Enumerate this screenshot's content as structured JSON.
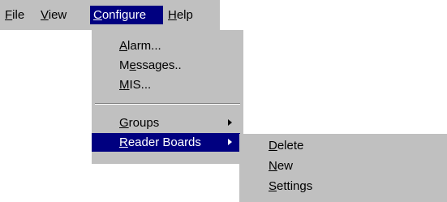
{
  "menubar": {
    "items": [
      {
        "mnemonic": "F",
        "rest": "ile"
      },
      {
        "mnemonic": "V",
        "rest": "iew"
      },
      {
        "mnemonic": "C",
        "rest": "onfigure"
      },
      {
        "mnemonic": "H",
        "rest": "elp"
      }
    ]
  },
  "configure_menu": {
    "items": [
      {
        "pre": "",
        "mnemonic": "A",
        "rest": "larm..."
      },
      {
        "pre": "M",
        "mnemonic": "e",
        "rest": "ssages.."
      },
      {
        "pre": "",
        "mnemonic": "M",
        "rest": "IS..."
      },
      {
        "pre": "",
        "mnemonic": "G",
        "rest": "roups"
      },
      {
        "pre": "",
        "mnemonic": "R",
        "rest": "eader Boards"
      }
    ]
  },
  "reader_boards_submenu": {
    "items": [
      {
        "mnemonic": "D",
        "rest": "elete"
      },
      {
        "mnemonic": "N",
        "rest": "ew"
      },
      {
        "mnemonic": "S",
        "rest": "ettings"
      }
    ]
  },
  "colors": {
    "menu_background": "#c0c0c0",
    "highlight": "#000080",
    "highlight_text": "#ffffff"
  }
}
